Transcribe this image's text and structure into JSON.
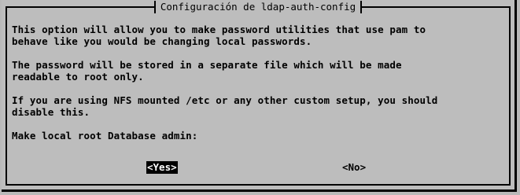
{
  "dialog": {
    "title": "Configuración de ldap-auth-config",
    "paragraphs": [
      "This option will allow you to make password utilities that use pam to\nbehave like you would be changing local passwords.",
      "The password will be stored in a separate file which will be made\nreadable to root only.",
      "If you are using NFS mounted /etc or any other custom setup, you should\ndisable this."
    ],
    "prompt": "Make local root Database admin:",
    "buttons": {
      "yes": "<Yes>",
      "no": "<No>"
    }
  },
  "colors": {
    "background": "#bdbdbd",
    "border": "#000000",
    "selected_button_bg": "#000000",
    "selected_button_fg": "#ffffff"
  }
}
